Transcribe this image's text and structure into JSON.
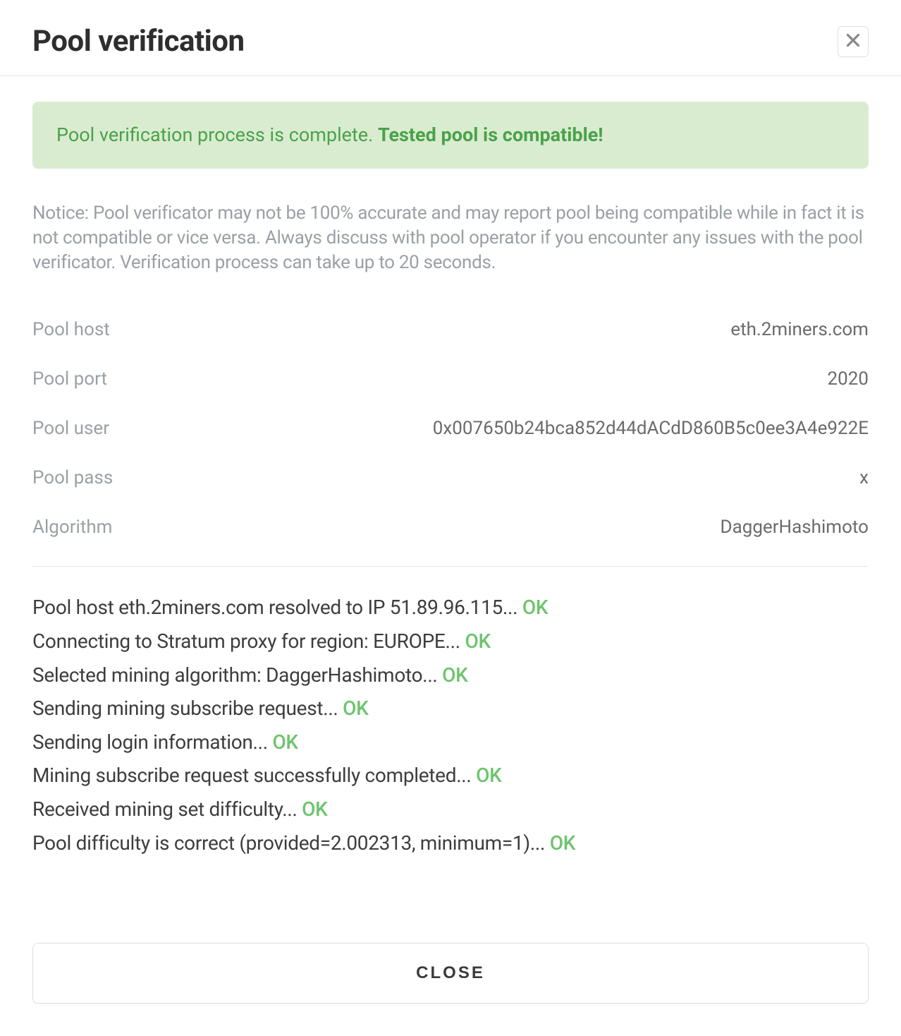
{
  "header": {
    "title": "Pool verification"
  },
  "alert": {
    "text": "Pool verification process is complete. ",
    "strong": "Tested pool is compatible!"
  },
  "notice": "Notice: Pool verificator may not be 100% accurate and may report pool being compatible while in fact it is not compatible or vice versa. Always discuss with pool operator if you encounter any issues with the pool verificator. Verification process can take up to 20 seconds.",
  "details": {
    "rows": [
      {
        "label": "Pool host",
        "value": "eth.2miners.com"
      },
      {
        "label": "Pool port",
        "value": "2020"
      },
      {
        "label": "Pool user",
        "value": "0x007650b24bca852d44dACdD860B5c0ee3A4e922E"
      },
      {
        "label": "Pool pass",
        "value": "x"
      },
      {
        "label": "Algorithm",
        "value": "DaggerHashimoto"
      }
    ]
  },
  "log": {
    "ok_label": "OK",
    "lines": [
      "Pool host eth.2miners.com resolved to IP 51.89.96.115... ",
      "Connecting to Stratum proxy for region: EUROPE... ",
      "Selected mining algorithm: DaggerHashimoto... ",
      "Sending mining subscribe request... ",
      "Sending login information... ",
      "Mining subscribe request successfully completed... ",
      "Received mining set difficulty... ",
      "Pool difficulty is correct (provided=2.002313, minimum=1)... "
    ]
  },
  "footer": {
    "close_label": "CLOSE"
  }
}
